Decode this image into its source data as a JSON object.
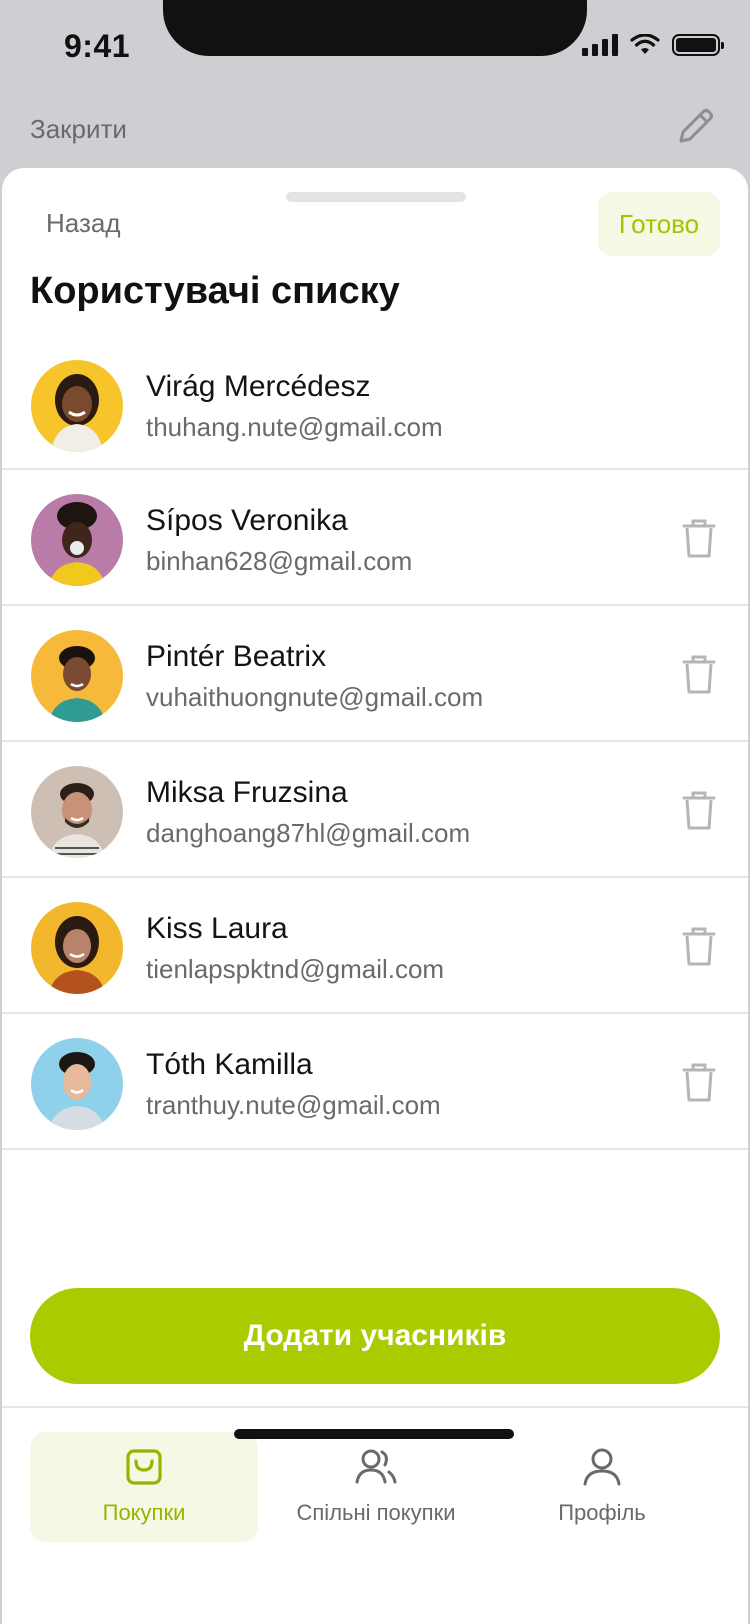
{
  "status_bar": {
    "time": "9:41"
  },
  "header": {
    "close_label": "Закрити"
  },
  "sheet": {
    "back_label": "Назад",
    "done_label": "Готово",
    "title": "Користувачі списку"
  },
  "users": [
    {
      "name": "Virág Mercédesz",
      "email": "thuhang.nute@gmail.com"
    },
    {
      "name": "Sípos Veronika",
      "email": "binhan628@gmail.com"
    },
    {
      "name": "Pintér Beatrix",
      "email": "vuhaithuongnute@gmail.com"
    },
    {
      "name": "Miksa Fruzsina",
      "email": "danghoang87hl@gmail.com"
    },
    {
      "name": "Kiss Laura",
      "email": "tienlapspktnd@gmail.com"
    },
    {
      "name": "Tóth Kamilla",
      "email": "tranthuy.nute@gmail.com"
    }
  ],
  "add_button_label": "Додати учасників",
  "tabs": [
    {
      "label": "Покупки",
      "icon": "shopping-bag-icon",
      "active": true
    },
    {
      "label": "Спільні покупки",
      "icon": "users-icon",
      "active": false
    },
    {
      "label": "Профіль",
      "icon": "user-icon",
      "active": false
    }
  ],
  "colors": {
    "accent": "#abcb00",
    "accent_light": "#f4f8e4",
    "text_secondary": "#6a6a6d"
  }
}
